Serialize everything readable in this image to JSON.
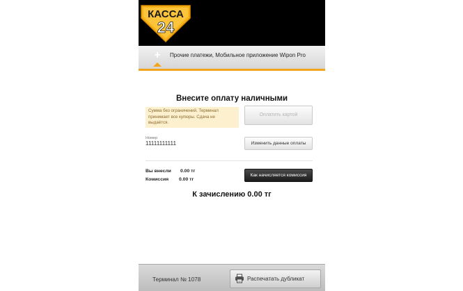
{
  "logo": {
    "line1": "КАССА",
    "line2": "24"
  },
  "breadcrumb": {
    "plus_icon": "plus-icon",
    "text": "Прочие платежи, Мобильное приложение Wipon Pro"
  },
  "title": "Внесите оплату наличными",
  "notice": "Сумма без ограничений. Терминал принимает все купюры. Сдача не выдаётся.",
  "buttons": {
    "pay_card": "Оплатить картой",
    "change_data": "Изменить данные оплаты",
    "commission": "Как начисляется комиссия",
    "print_duplicate": "Распечатать дубликат"
  },
  "number_field": {
    "label": "Номер",
    "value": "11111111111"
  },
  "stats": {
    "paid_label": "Вы внесли",
    "paid_value": "0.00 тг",
    "commission_label": "Комиссия",
    "commission_value": "0.00 тг"
  },
  "credit_total": "К зачислению 0.00 тг",
  "footer": {
    "terminal": "Терминал № 1078",
    "print_icon": "printer-icon"
  },
  "colors": {
    "accent": "#f5a51c",
    "topbar": "#000000",
    "notice_bg": "#fdf0cf"
  }
}
